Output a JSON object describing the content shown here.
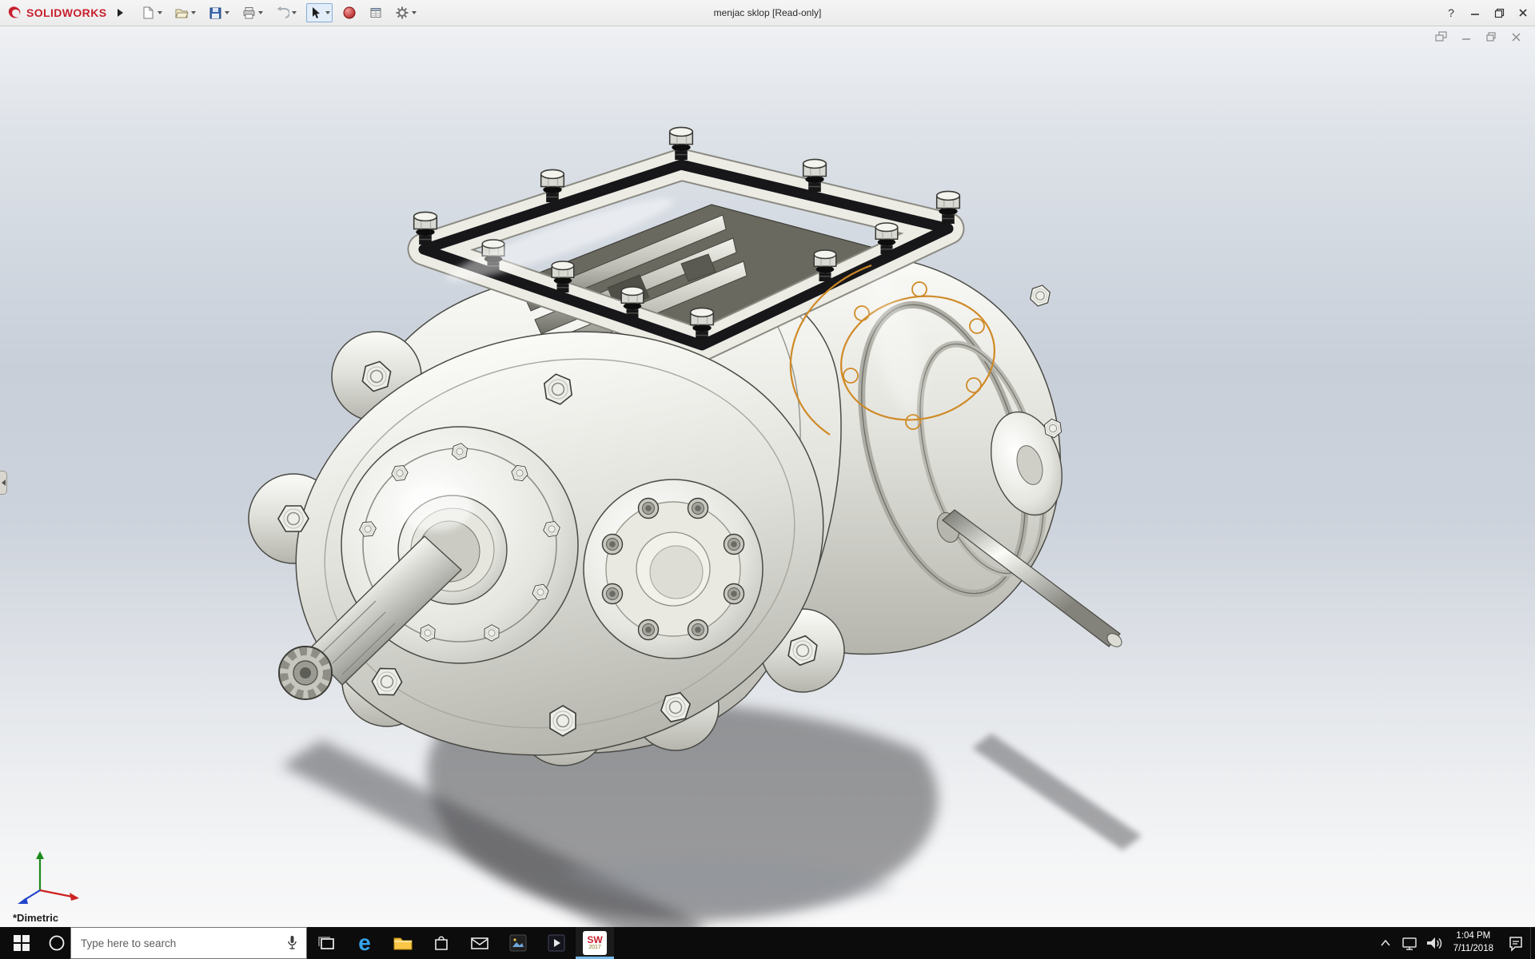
{
  "app": {
    "brand_name": "SOLIDWORKS",
    "document_title": "menjac sklop [Read-only]",
    "help_label": "?"
  },
  "toolbar": {
    "icons": [
      "new-document",
      "open",
      "save",
      "print",
      "undo",
      "select-arrow",
      "appearances-sphere",
      "report-table",
      "options-gear"
    ]
  },
  "viewport": {
    "view_orientation_label": "*Dimetric",
    "selection_color": "#cf8a26"
  },
  "taskbar": {
    "search_placeholder": "Type here to search",
    "clock": {
      "time": "1:04 PM",
      "date": "7/11/2018"
    },
    "solidworks_badge": {
      "label": "SW",
      "year": "2017"
    }
  }
}
